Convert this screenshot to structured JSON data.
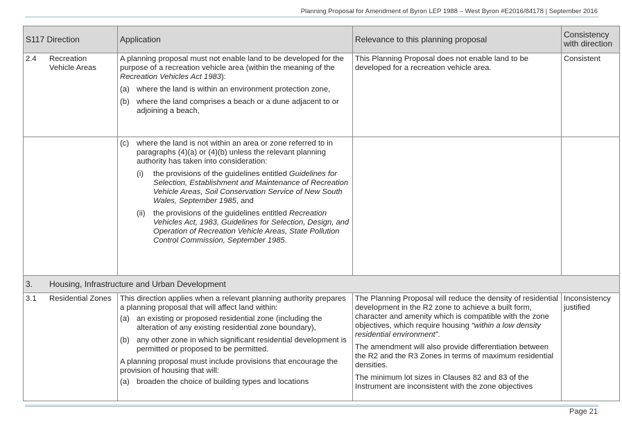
{
  "header": {
    "running_title": "Planning Proposal for Amendment of Byron LEP 1988 – West Byron #E2016/84178 | September  2016"
  },
  "footer": {
    "page": "Page 21"
  },
  "table": {
    "columns": [
      "S117 Direction",
      "Application",
      "Relevance to this planning proposal",
      "Consistency with direction"
    ],
    "row24": {
      "num": "2.4",
      "direction": "Recreation Vehicle Areas",
      "app_intro_a": "A planning proposal must not enable land to be developed for the purpose of a recreation vehicle area (within the meaning of the ",
      "app_intro_italic": "Recreation Vehicles Act 1983",
      "app_intro_b": "):",
      "item_a_lbl": "(a)",
      "item_a": "where the land is within an environment protection zone,",
      "item_b_lbl": "(b)",
      "item_b": "where the land comprises a beach or a dune adjacent to or adjoining a beach,",
      "relevance": "This Planning Proposal does not enable land to be developed for a recreation vehicle area.",
      "consistency": "Consistent"
    },
    "row24b": {
      "item_c_lbl": "(c)",
      "item_c": "where the land is not within an area or zone referred to in paragraphs (4)(a) or (4)(b) unless the relevant planning authority has taken into consideration:",
      "sub_i_lbl": "(i)",
      "sub_i_a": "the provisions of the guidelines entitled ",
      "sub_i_italic": "Guidelines for Selection, Establishment and Maintenance of Recreation Vehicle Areas, Soil Conservation Service of New South Wales, September 1985",
      "sub_i_b": ", and",
      "sub_ii_lbl": "(ii)",
      "sub_ii_a": "the provisions of the guidelines entitled ",
      "sub_ii_italic": "Recreation Vehicles Act, 1983, Guidelines for Selection, Design, and Operation of Recreation Vehicle Areas, State Pollution Control Commission, September 1985",
      "sub_ii_b": "."
    },
    "section3": {
      "num": "3.",
      "title": "Housing, Infrastructure and Urban Development"
    },
    "row31": {
      "num": "3.1",
      "direction": "Residential Zones",
      "app_intro": "This direction applies when a relevant planning authority prepares a planning proposal that will affect land within:",
      "item_a_lbl": "(a)",
      "item_a": "an existing or proposed residential zone (including the alteration of any existing residential zone boundary),",
      "item_b_lbl": "(b)",
      "item_b": "any other zone in which significant residential development is permitted or proposed to be permitted.",
      "app_p2": "A planning proposal must include provisions that encourage the provision of housing that will:",
      "item_a2_lbl": "(a)",
      "item_a2": "broaden the choice of building types and locations",
      "rel_p1": "The Planning Proposal will reduce the density of residential development in the R2 zone to achieve a built form, character and amenity which is compatible with the zone objectives, which require housing ",
      "rel_p1_italic": "“within a low density residential environment”",
      "rel_p1_end": ".",
      "rel_p2": "The amendment will also provide differentiation between the R2 and the R3 Zones in terms of maximum residential densities.",
      "rel_p3": "The minimum lot sizes in Clauses 82 and 83 of the Instrument are inconsistent with the zone objectives",
      "consistency": "Inconsistency justified"
    }
  }
}
